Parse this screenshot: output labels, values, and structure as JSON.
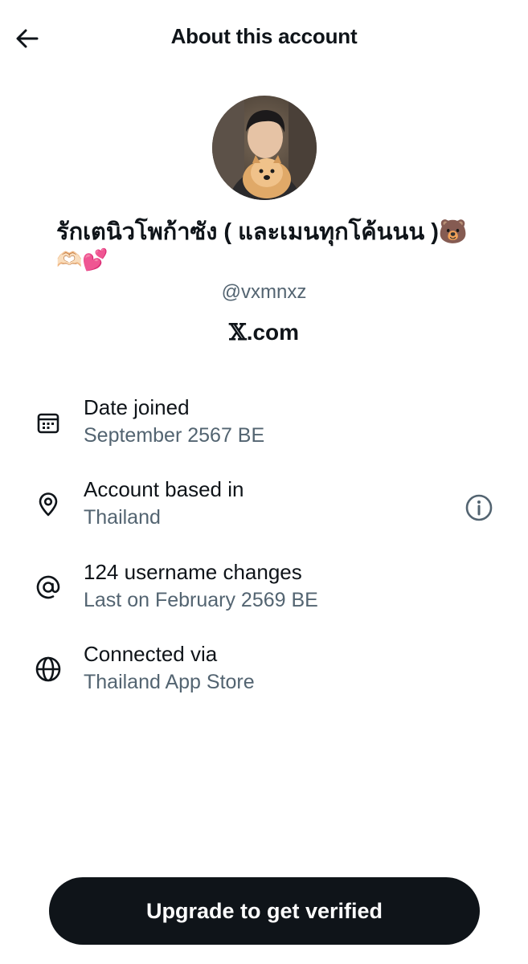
{
  "header": {
    "title": "About this account",
    "back_icon": "arrow-left-icon"
  },
  "profile": {
    "display_name": "รักเตนิวโพก้าซัง ( และเมนทุกโค้นนน )🐻",
    "display_name_emoji": "🫶🏻💕",
    "handle": "@vxmnxz",
    "site_glyph": "𝕏",
    "site_suffix": ".com"
  },
  "info": [
    {
      "icon": "calendar-icon",
      "label": "Date joined",
      "value": "September 2567 BE"
    },
    {
      "icon": "location-pin-icon",
      "label": "Account based in",
      "value": "Thailand",
      "extra_icon": "info-circle-icon"
    },
    {
      "icon": "at-sign-icon",
      "label": "124 username changes",
      "value": "Last on February 2569 BE"
    },
    {
      "icon": "globe-icon",
      "label": "Connected via",
      "value": "Thailand App Store"
    }
  ],
  "cta": {
    "label": "Upgrade to get verified"
  },
  "colors": {
    "text_primary": "#0f1419",
    "text_secondary": "#536471",
    "button_bg": "#0f1419",
    "button_text": "#ffffff"
  }
}
